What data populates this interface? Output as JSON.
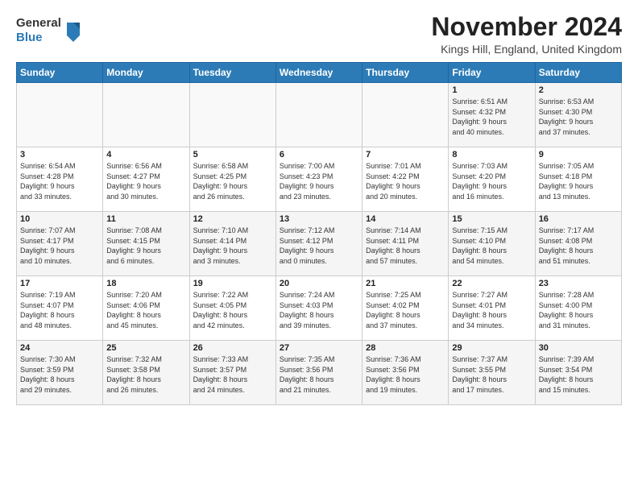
{
  "header": {
    "logo_general": "General",
    "logo_blue": "Blue",
    "month_title": "November 2024",
    "location": "Kings Hill, England, United Kingdom"
  },
  "days_of_week": [
    "Sunday",
    "Monday",
    "Tuesday",
    "Wednesday",
    "Thursday",
    "Friday",
    "Saturday"
  ],
  "weeks": [
    [
      {
        "day": "",
        "info": ""
      },
      {
        "day": "",
        "info": ""
      },
      {
        "day": "",
        "info": ""
      },
      {
        "day": "",
        "info": ""
      },
      {
        "day": "",
        "info": ""
      },
      {
        "day": "1",
        "info": "Sunrise: 6:51 AM\nSunset: 4:32 PM\nDaylight: 9 hours\nand 40 minutes."
      },
      {
        "day": "2",
        "info": "Sunrise: 6:53 AM\nSunset: 4:30 PM\nDaylight: 9 hours\nand 37 minutes."
      }
    ],
    [
      {
        "day": "3",
        "info": "Sunrise: 6:54 AM\nSunset: 4:28 PM\nDaylight: 9 hours\nand 33 minutes."
      },
      {
        "day": "4",
        "info": "Sunrise: 6:56 AM\nSunset: 4:27 PM\nDaylight: 9 hours\nand 30 minutes."
      },
      {
        "day": "5",
        "info": "Sunrise: 6:58 AM\nSunset: 4:25 PM\nDaylight: 9 hours\nand 26 minutes."
      },
      {
        "day": "6",
        "info": "Sunrise: 7:00 AM\nSunset: 4:23 PM\nDaylight: 9 hours\nand 23 minutes."
      },
      {
        "day": "7",
        "info": "Sunrise: 7:01 AM\nSunset: 4:22 PM\nDaylight: 9 hours\nand 20 minutes."
      },
      {
        "day": "8",
        "info": "Sunrise: 7:03 AM\nSunset: 4:20 PM\nDaylight: 9 hours\nand 16 minutes."
      },
      {
        "day": "9",
        "info": "Sunrise: 7:05 AM\nSunset: 4:18 PM\nDaylight: 9 hours\nand 13 minutes."
      }
    ],
    [
      {
        "day": "10",
        "info": "Sunrise: 7:07 AM\nSunset: 4:17 PM\nDaylight: 9 hours\nand 10 minutes."
      },
      {
        "day": "11",
        "info": "Sunrise: 7:08 AM\nSunset: 4:15 PM\nDaylight: 9 hours\nand 6 minutes."
      },
      {
        "day": "12",
        "info": "Sunrise: 7:10 AM\nSunset: 4:14 PM\nDaylight: 9 hours\nand 3 minutes."
      },
      {
        "day": "13",
        "info": "Sunrise: 7:12 AM\nSunset: 4:12 PM\nDaylight: 9 hours\nand 0 minutes."
      },
      {
        "day": "14",
        "info": "Sunrise: 7:14 AM\nSunset: 4:11 PM\nDaylight: 8 hours\nand 57 minutes."
      },
      {
        "day": "15",
        "info": "Sunrise: 7:15 AM\nSunset: 4:10 PM\nDaylight: 8 hours\nand 54 minutes."
      },
      {
        "day": "16",
        "info": "Sunrise: 7:17 AM\nSunset: 4:08 PM\nDaylight: 8 hours\nand 51 minutes."
      }
    ],
    [
      {
        "day": "17",
        "info": "Sunrise: 7:19 AM\nSunset: 4:07 PM\nDaylight: 8 hours\nand 48 minutes."
      },
      {
        "day": "18",
        "info": "Sunrise: 7:20 AM\nSunset: 4:06 PM\nDaylight: 8 hours\nand 45 minutes."
      },
      {
        "day": "19",
        "info": "Sunrise: 7:22 AM\nSunset: 4:05 PM\nDaylight: 8 hours\nand 42 minutes."
      },
      {
        "day": "20",
        "info": "Sunrise: 7:24 AM\nSunset: 4:03 PM\nDaylight: 8 hours\nand 39 minutes."
      },
      {
        "day": "21",
        "info": "Sunrise: 7:25 AM\nSunset: 4:02 PM\nDaylight: 8 hours\nand 37 minutes."
      },
      {
        "day": "22",
        "info": "Sunrise: 7:27 AM\nSunset: 4:01 PM\nDaylight: 8 hours\nand 34 minutes."
      },
      {
        "day": "23",
        "info": "Sunrise: 7:28 AM\nSunset: 4:00 PM\nDaylight: 8 hours\nand 31 minutes."
      }
    ],
    [
      {
        "day": "24",
        "info": "Sunrise: 7:30 AM\nSunset: 3:59 PM\nDaylight: 8 hours\nand 29 minutes."
      },
      {
        "day": "25",
        "info": "Sunrise: 7:32 AM\nSunset: 3:58 PM\nDaylight: 8 hours\nand 26 minutes."
      },
      {
        "day": "26",
        "info": "Sunrise: 7:33 AM\nSunset: 3:57 PM\nDaylight: 8 hours\nand 24 minutes."
      },
      {
        "day": "27",
        "info": "Sunrise: 7:35 AM\nSunset: 3:56 PM\nDaylight: 8 hours\nand 21 minutes."
      },
      {
        "day": "28",
        "info": "Sunrise: 7:36 AM\nSunset: 3:56 PM\nDaylight: 8 hours\nand 19 minutes."
      },
      {
        "day": "29",
        "info": "Sunrise: 7:37 AM\nSunset: 3:55 PM\nDaylight: 8 hours\nand 17 minutes."
      },
      {
        "day": "30",
        "info": "Sunrise: 7:39 AM\nSunset: 3:54 PM\nDaylight: 8 hours\nand 15 minutes."
      }
    ]
  ]
}
